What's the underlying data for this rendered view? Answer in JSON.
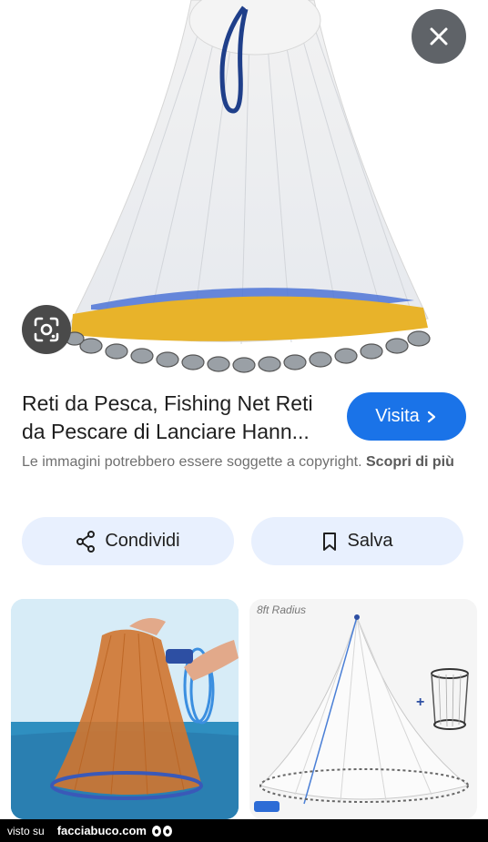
{
  "result": {
    "title": "Reti da Pesca, Fishing Net Reti da Pescare di Lanciare Hann...",
    "visit_label": "Visita",
    "copyright_text": "Le immagini potrebbero essere soggette a copyright.",
    "learn_more": "Scopri di più"
  },
  "actions": {
    "share_label": "Condividi",
    "save_label": "Salva"
  },
  "related": {
    "right_caption": "8ft Radius"
  },
  "footer": {
    "prefix": "visto su",
    "brand": "facciabuco.com"
  },
  "colors": {
    "accent": "#1a73e8",
    "action_bg": "#e8f0fe",
    "close_bg": "#5f6368"
  },
  "icons": [
    "close-icon",
    "lens-icon",
    "chevron-right-icon",
    "share-icon",
    "bookmark-icon",
    "facciabuco-eyes-icon"
  ]
}
